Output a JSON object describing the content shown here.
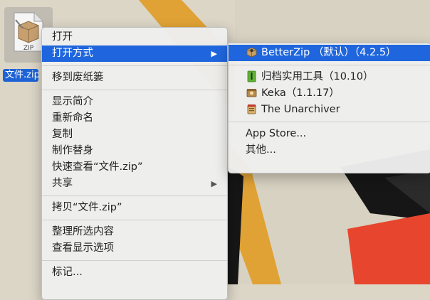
{
  "file": {
    "name": "文件.zip",
    "icon_text": "ZIP"
  },
  "context_menu": {
    "items": [
      {
        "label": "打开"
      },
      {
        "label": "打开方式",
        "submenu": true,
        "active": true
      },
      {
        "label": "移到废纸篓"
      },
      {
        "label": "显示简介"
      },
      {
        "label": "重新命名"
      },
      {
        "label": "复制"
      },
      {
        "label": "制作替身"
      },
      {
        "label": "快速查看“文件.zip”"
      },
      {
        "label": "共享",
        "submenu": true
      },
      {
        "label": "拷贝“文件.zip”"
      },
      {
        "label": "整理所选内容"
      },
      {
        "label": "查看显示选项"
      },
      {
        "label": "标记..."
      }
    ]
  },
  "open_with_submenu": {
    "items": [
      {
        "label": "BetterZip （默认）（4.2.5）",
        "icon": "betterzip-icon",
        "active": true
      },
      {
        "label": "归档实用工具（10.10）",
        "icon": "archive-utility-icon"
      },
      {
        "label": "Keka（1.1.17）",
        "icon": "keka-icon"
      },
      {
        "label": "The Unarchiver",
        "icon": "unarchiver-icon"
      },
      {
        "label": "App Store..."
      },
      {
        "label": "其他..."
      }
    ]
  },
  "colors": {
    "highlight": "#1f66de",
    "desktop_yellow": "#e0a235",
    "desktop_red": "#e7452d"
  }
}
